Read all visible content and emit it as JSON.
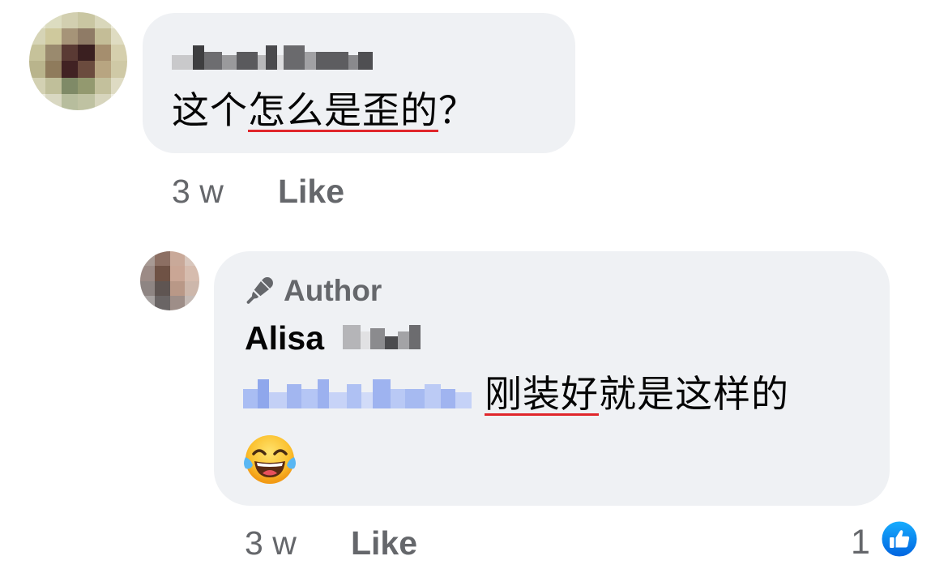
{
  "comment_1": {
    "text_prefix": "这个",
    "text_underlined": "怎么是歪的",
    "text_suffix": "？",
    "time": "3 w",
    "like_label": "Like"
  },
  "reply": {
    "badge_label": "Author",
    "badge_icon": "microphone-icon",
    "author_first_name": "Alisa",
    "text_underlined": "刚装好",
    "text_rest": "就是这样的",
    "emoji": "😂",
    "time": "3 w",
    "like_label": "Like",
    "reaction_count": "1",
    "reaction_icon": "thumbs-up-icon"
  },
  "colors": {
    "bubble": "#eff1f4",
    "meta_text": "#65676b",
    "like_blue": "#1877f2",
    "underline_red": "#e0262b",
    "mention_blur": "#aebff0"
  }
}
